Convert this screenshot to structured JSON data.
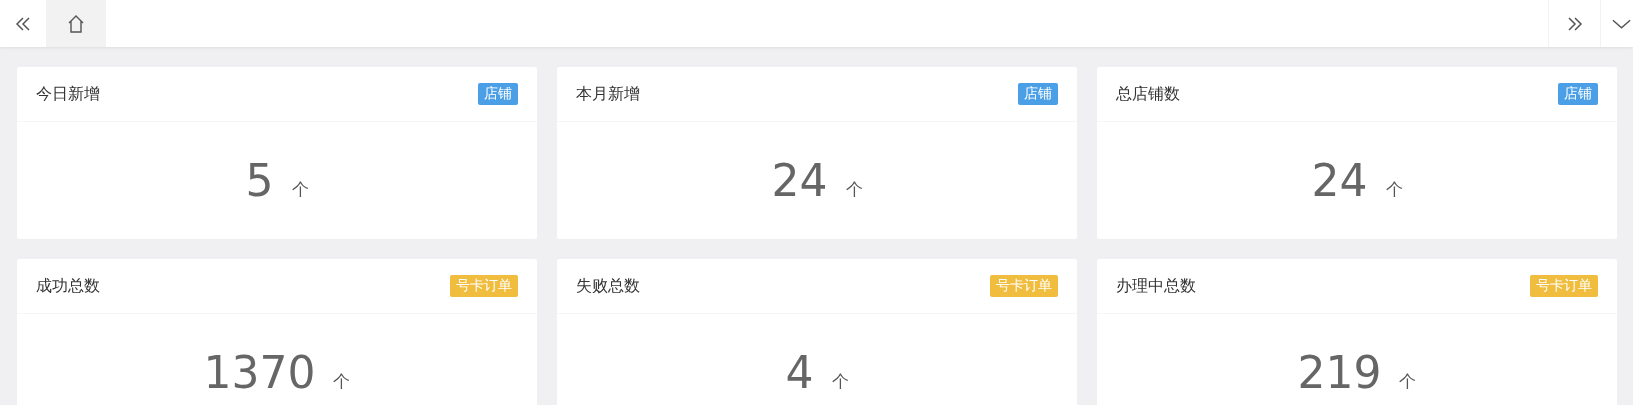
{
  "tabs": [
    {
      "kind": "home",
      "selected": true
    }
  ],
  "cards": [
    {
      "title": "今日新增",
      "tag": "店铺",
      "color": "#4a9fe6",
      "value": "5",
      "unit": "个"
    },
    {
      "title": "本月新增",
      "tag": "店铺",
      "color": "#4a9fe6",
      "value": "24",
      "unit": "个"
    },
    {
      "title": "总店铺数",
      "tag": "店铺",
      "color": "#4a9fe6",
      "value": "24",
      "unit": "个"
    },
    {
      "title": "成功总数",
      "tag": "号卡订单",
      "color": "#f0bd3e",
      "value": "1370",
      "unit": "个"
    },
    {
      "title": "失败总数",
      "tag": "号卡订单",
      "color": "#f0bd3e",
      "value": "4",
      "unit": "个"
    },
    {
      "title": "办理中总数",
      "tag": "号卡订单",
      "color": "#f0bd3e",
      "value": "219",
      "unit": "个"
    }
  ]
}
